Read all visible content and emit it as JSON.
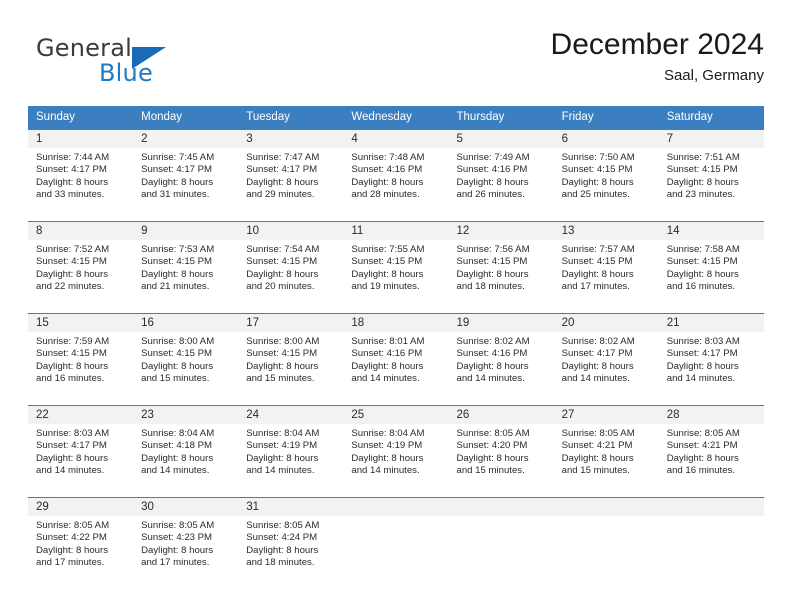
{
  "brand": {
    "name_part1": "General",
    "name_part2": "Blue",
    "accent_color": "#1a6bb5"
  },
  "header": {
    "month_title": "December 2024",
    "location": "Saal, Germany"
  },
  "calendar": {
    "header_bg": "#3c7fc1",
    "day_band_bg": "#f2f2f2",
    "weekdays": [
      "Sunday",
      "Monday",
      "Tuesday",
      "Wednesday",
      "Thursday",
      "Friday",
      "Saturday"
    ],
    "weeks": [
      [
        {
          "day": "1",
          "sunrise": "Sunrise: 7:44 AM",
          "sunset": "Sunset: 4:17 PM",
          "daylight_line1": "Daylight: 8 hours",
          "daylight_line2": "and 33 minutes."
        },
        {
          "day": "2",
          "sunrise": "Sunrise: 7:45 AM",
          "sunset": "Sunset: 4:17 PM",
          "daylight_line1": "Daylight: 8 hours",
          "daylight_line2": "and 31 minutes."
        },
        {
          "day": "3",
          "sunrise": "Sunrise: 7:47 AM",
          "sunset": "Sunset: 4:17 PM",
          "daylight_line1": "Daylight: 8 hours",
          "daylight_line2": "and 29 minutes."
        },
        {
          "day": "4",
          "sunrise": "Sunrise: 7:48 AM",
          "sunset": "Sunset: 4:16 PM",
          "daylight_line1": "Daylight: 8 hours",
          "daylight_line2": "and 28 minutes."
        },
        {
          "day": "5",
          "sunrise": "Sunrise: 7:49 AM",
          "sunset": "Sunset: 4:16 PM",
          "daylight_line1": "Daylight: 8 hours",
          "daylight_line2": "and 26 minutes."
        },
        {
          "day": "6",
          "sunrise": "Sunrise: 7:50 AM",
          "sunset": "Sunset: 4:15 PM",
          "daylight_line1": "Daylight: 8 hours",
          "daylight_line2": "and 25 minutes."
        },
        {
          "day": "7",
          "sunrise": "Sunrise: 7:51 AM",
          "sunset": "Sunset: 4:15 PM",
          "daylight_line1": "Daylight: 8 hours",
          "daylight_line2": "and 23 minutes."
        }
      ],
      [
        {
          "day": "8",
          "sunrise": "Sunrise: 7:52 AM",
          "sunset": "Sunset: 4:15 PM",
          "daylight_line1": "Daylight: 8 hours",
          "daylight_line2": "and 22 minutes."
        },
        {
          "day": "9",
          "sunrise": "Sunrise: 7:53 AM",
          "sunset": "Sunset: 4:15 PM",
          "daylight_line1": "Daylight: 8 hours",
          "daylight_line2": "and 21 minutes."
        },
        {
          "day": "10",
          "sunrise": "Sunrise: 7:54 AM",
          "sunset": "Sunset: 4:15 PM",
          "daylight_line1": "Daylight: 8 hours",
          "daylight_line2": "and 20 minutes."
        },
        {
          "day": "11",
          "sunrise": "Sunrise: 7:55 AM",
          "sunset": "Sunset: 4:15 PM",
          "daylight_line1": "Daylight: 8 hours",
          "daylight_line2": "and 19 minutes."
        },
        {
          "day": "12",
          "sunrise": "Sunrise: 7:56 AM",
          "sunset": "Sunset: 4:15 PM",
          "daylight_line1": "Daylight: 8 hours",
          "daylight_line2": "and 18 minutes."
        },
        {
          "day": "13",
          "sunrise": "Sunrise: 7:57 AM",
          "sunset": "Sunset: 4:15 PM",
          "daylight_line1": "Daylight: 8 hours",
          "daylight_line2": "and 17 minutes."
        },
        {
          "day": "14",
          "sunrise": "Sunrise: 7:58 AM",
          "sunset": "Sunset: 4:15 PM",
          "daylight_line1": "Daylight: 8 hours",
          "daylight_line2": "and 16 minutes."
        }
      ],
      [
        {
          "day": "15",
          "sunrise": "Sunrise: 7:59 AM",
          "sunset": "Sunset: 4:15 PM",
          "daylight_line1": "Daylight: 8 hours",
          "daylight_line2": "and 16 minutes."
        },
        {
          "day": "16",
          "sunrise": "Sunrise: 8:00 AM",
          "sunset": "Sunset: 4:15 PM",
          "daylight_line1": "Daylight: 8 hours",
          "daylight_line2": "and 15 minutes."
        },
        {
          "day": "17",
          "sunrise": "Sunrise: 8:00 AM",
          "sunset": "Sunset: 4:15 PM",
          "daylight_line1": "Daylight: 8 hours",
          "daylight_line2": "and 15 minutes."
        },
        {
          "day": "18",
          "sunrise": "Sunrise: 8:01 AM",
          "sunset": "Sunset: 4:16 PM",
          "daylight_line1": "Daylight: 8 hours",
          "daylight_line2": "and 14 minutes."
        },
        {
          "day": "19",
          "sunrise": "Sunrise: 8:02 AM",
          "sunset": "Sunset: 4:16 PM",
          "daylight_line1": "Daylight: 8 hours",
          "daylight_line2": "and 14 minutes."
        },
        {
          "day": "20",
          "sunrise": "Sunrise: 8:02 AM",
          "sunset": "Sunset: 4:17 PM",
          "daylight_line1": "Daylight: 8 hours",
          "daylight_line2": "and 14 minutes."
        },
        {
          "day": "21",
          "sunrise": "Sunrise: 8:03 AM",
          "sunset": "Sunset: 4:17 PM",
          "daylight_line1": "Daylight: 8 hours",
          "daylight_line2": "and 14 minutes."
        }
      ],
      [
        {
          "day": "22",
          "sunrise": "Sunrise: 8:03 AM",
          "sunset": "Sunset: 4:17 PM",
          "daylight_line1": "Daylight: 8 hours",
          "daylight_line2": "and 14 minutes."
        },
        {
          "day": "23",
          "sunrise": "Sunrise: 8:04 AM",
          "sunset": "Sunset: 4:18 PM",
          "daylight_line1": "Daylight: 8 hours",
          "daylight_line2": "and 14 minutes."
        },
        {
          "day": "24",
          "sunrise": "Sunrise: 8:04 AM",
          "sunset": "Sunset: 4:19 PM",
          "daylight_line1": "Daylight: 8 hours",
          "daylight_line2": "and 14 minutes."
        },
        {
          "day": "25",
          "sunrise": "Sunrise: 8:04 AM",
          "sunset": "Sunset: 4:19 PM",
          "daylight_line1": "Daylight: 8 hours",
          "daylight_line2": "and 14 minutes."
        },
        {
          "day": "26",
          "sunrise": "Sunrise: 8:05 AM",
          "sunset": "Sunset: 4:20 PM",
          "daylight_line1": "Daylight: 8 hours",
          "daylight_line2": "and 15 minutes."
        },
        {
          "day": "27",
          "sunrise": "Sunrise: 8:05 AM",
          "sunset": "Sunset: 4:21 PM",
          "daylight_line1": "Daylight: 8 hours",
          "daylight_line2": "and 15 minutes."
        },
        {
          "day": "28",
          "sunrise": "Sunrise: 8:05 AM",
          "sunset": "Sunset: 4:21 PM",
          "daylight_line1": "Daylight: 8 hours",
          "daylight_line2": "and 16 minutes."
        }
      ],
      [
        {
          "day": "29",
          "sunrise": "Sunrise: 8:05 AM",
          "sunset": "Sunset: 4:22 PM",
          "daylight_line1": "Daylight: 8 hours",
          "daylight_line2": "and 17 minutes."
        },
        {
          "day": "30",
          "sunrise": "Sunrise: 8:05 AM",
          "sunset": "Sunset: 4:23 PM",
          "daylight_line1": "Daylight: 8 hours",
          "daylight_line2": "and 17 minutes."
        },
        {
          "day": "31",
          "sunrise": "Sunrise: 8:05 AM",
          "sunset": "Sunset: 4:24 PM",
          "daylight_line1": "Daylight: 8 hours",
          "daylight_line2": "and 18 minutes."
        },
        {
          "day": "",
          "sunrise": "",
          "sunset": "",
          "daylight_line1": "",
          "daylight_line2": ""
        },
        {
          "day": "",
          "sunrise": "",
          "sunset": "",
          "daylight_line1": "",
          "daylight_line2": ""
        },
        {
          "day": "",
          "sunrise": "",
          "sunset": "",
          "daylight_line1": "",
          "daylight_line2": ""
        },
        {
          "day": "",
          "sunrise": "",
          "sunset": "",
          "daylight_line1": "",
          "daylight_line2": ""
        }
      ]
    ]
  }
}
